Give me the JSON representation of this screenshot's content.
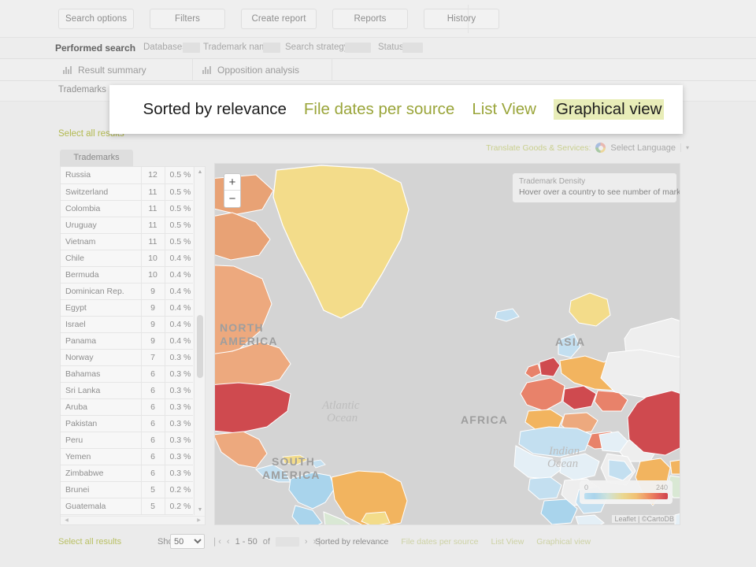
{
  "toolbar": {
    "buttons": [
      {
        "label": "Search options",
        "name": "search-options-button"
      },
      {
        "label": "Filters",
        "name": "filters-button"
      },
      {
        "label": "Create report",
        "name": "create-report-button"
      },
      {
        "label": "Reports",
        "name": "reports-button"
      },
      {
        "label": "History",
        "name": "history-button"
      }
    ]
  },
  "performed_search": {
    "title": "Performed search",
    "fields": [
      {
        "label": "Databases:",
        "value": ""
      },
      {
        "label": "Trademark name:",
        "value": ""
      },
      {
        "label": "Search strategy:",
        "value": ""
      },
      {
        "label": "Status:",
        "value": ""
      }
    ]
  },
  "analysis_tabs": [
    {
      "label": "Result summary",
      "icon": "bar-chart-icon"
    },
    {
      "label": "Opposition analysis",
      "icon": "bar-chart-icon"
    }
  ],
  "section": {
    "trademarks_label": "Trademarks",
    "select_all_top": "Select all results",
    "panel_tab": "Trademarks"
  },
  "translate": {
    "label": "Translate Goods & Services:",
    "icon": "google-icon",
    "selected_language": "Select Language",
    "caret": "▾"
  },
  "table": {
    "rows": [
      {
        "country": "Russia",
        "count": "12",
        "percent": "0.5 %"
      },
      {
        "country": "Switzerland",
        "count": "11",
        "percent": "0.5 %"
      },
      {
        "country": "Colombia",
        "count": "11",
        "percent": "0.5 %"
      },
      {
        "country": "Uruguay",
        "count": "11",
        "percent": "0.5 %"
      },
      {
        "country": "Vietnam",
        "count": "11",
        "percent": "0.5 %"
      },
      {
        "country": "Chile",
        "count": "10",
        "percent": "0.4 %"
      },
      {
        "country": "Bermuda",
        "count": "10",
        "percent": "0.4 %"
      },
      {
        "country": "Dominican Rep.",
        "count": "9",
        "percent": "0.4 %"
      },
      {
        "country": "Egypt",
        "count": "9",
        "percent": "0.4 %"
      },
      {
        "country": "Israel",
        "count": "9",
        "percent": "0.4 %"
      },
      {
        "country": "Panama",
        "count": "9",
        "percent": "0.4 %"
      },
      {
        "country": "Norway",
        "count": "7",
        "percent": "0.3 %"
      },
      {
        "country": "Bahamas",
        "count": "6",
        "percent": "0.3 %"
      },
      {
        "country": "Sri Lanka",
        "count": "6",
        "percent": "0.3 %"
      },
      {
        "country": "Aruba",
        "count": "6",
        "percent": "0.3 %"
      },
      {
        "country": "Pakistan",
        "count": "6",
        "percent": "0.3 %"
      },
      {
        "country": "Peru",
        "count": "6",
        "percent": "0.3 %"
      },
      {
        "country": "Yemen",
        "count": "6",
        "percent": "0.3 %"
      },
      {
        "country": "Zimbabwe",
        "count": "6",
        "percent": "0.3 %"
      },
      {
        "country": "Brunei",
        "count": "5",
        "percent": "0.2 %"
      },
      {
        "country": "Guatemala",
        "count": "5",
        "percent": "0.2 %"
      }
    ]
  },
  "map": {
    "zoom_in": "+",
    "zoom_out": "−",
    "density_title": "Trademark Density",
    "density_hint": "Hover over a country to see number of marks",
    "legend_min": "0",
    "legend_max": "240",
    "attribution": "Leaflet | ©CartoDB",
    "ocean_labels": [
      "Atlantic Ocean",
      "Indian Ocean"
    ],
    "continent_labels": [
      "NORTH AMERICA",
      "SOUTH AMERICA",
      "AFRICA",
      "ASIA"
    ],
    "colors": {
      "very_high": "#cf4a4f",
      "high": "#e8826a",
      "mid_high": "#f2b45f",
      "mid": "#f3dc8a",
      "low": "#c3dff0",
      "very_low": "#e4eff6",
      "no_data": "#eeeeee",
      "ocean": "#d4d4d4"
    }
  },
  "overlay": {
    "items": [
      {
        "label": "Sorted by relevance",
        "style": "sorted",
        "name": "overlay-sorted-by-relevance"
      },
      {
        "label": "File dates per source",
        "style": "green",
        "name": "overlay-file-dates-per-source"
      },
      {
        "label": "List View",
        "style": "green",
        "name": "overlay-list-view"
      },
      {
        "label": "Graphical view",
        "style": "active",
        "name": "overlay-graphical-view"
      }
    ]
  },
  "bottom": {
    "select_all": "Select all results",
    "show_label": "Show:",
    "page_size": "50",
    "page_size_options": [
      "50"
    ],
    "first": "❘‹",
    "prev": "‹",
    "range": "1 - 50",
    "of": "of",
    "total": "",
    "next": "›",
    "last": "›❘",
    "links": [
      {
        "label": "Sorted by relevance",
        "style": "a1",
        "name": "footer-sorted-by-relevance"
      },
      {
        "label": "File dates per source",
        "style": "a2",
        "name": "footer-file-dates-per-source"
      },
      {
        "label": "List View",
        "style": "a2",
        "name": "footer-list-view"
      },
      {
        "label": "Graphical view",
        "style": "a2",
        "name": "footer-graphical-view"
      }
    ]
  }
}
